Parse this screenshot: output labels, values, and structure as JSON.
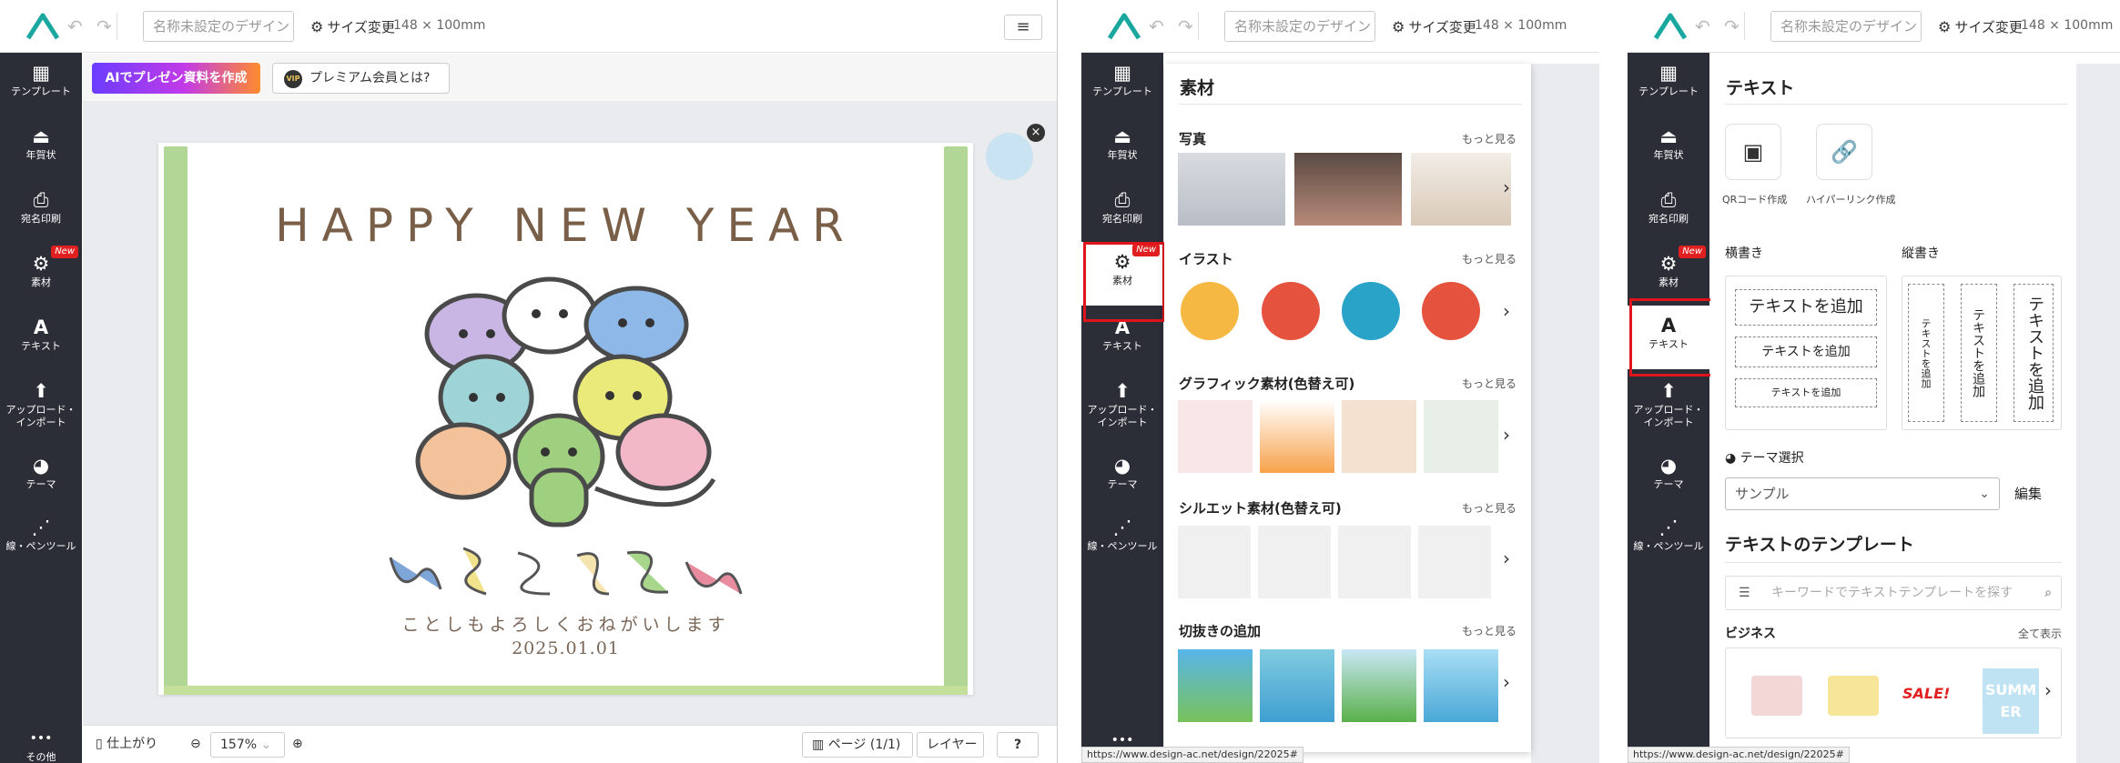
{
  "app": {
    "undo_icon": "undo-icon",
    "redo_icon": "redo-icon",
    "title_placeholder": "名称未設定のデザイン",
    "resize_label": "サイズ変更",
    "dimensions": "148 × 100mm",
    "menu_icon": "≡"
  },
  "sidebar": {
    "items": [
      {
        "icon": "▦",
        "label": "テンプレート"
      },
      {
        "icon": "⏏",
        "label": "年賀状"
      },
      {
        "icon": "⎙",
        "label": "宛名印刷"
      },
      {
        "icon": "⚙",
        "label": "素材",
        "badge": "New"
      },
      {
        "icon": "A",
        "label": "テキスト"
      },
      {
        "icon": "⬆",
        "label": "アップロード・\nインポート"
      },
      {
        "icon": "◕",
        "label": "テーマ"
      },
      {
        "icon": "⋰",
        "label": "線・ペンツール"
      }
    ],
    "more": {
      "icon": "•••",
      "label": "その他"
    }
  },
  "editor": {
    "ai_button": "AIでプレゼン資料を作成",
    "vip_badge": "VIP",
    "vip_button": "プレミアム会員とは?",
    "card": {
      "headline": "HAPPY NEW YEAR",
      "greeting": "ことしもよろしくおねがいします",
      "date": "2025.01.01"
    },
    "close_icon": "×",
    "bottom": {
      "finish": "仕上がり",
      "zoom": "157%",
      "page_label": "ページ",
      "page_count": "(1/1)",
      "layer": "レイヤー",
      "help": "?"
    }
  },
  "materials_panel": {
    "title": "素材",
    "more_label": "もっと見る",
    "sections": [
      {
        "label": "写真"
      },
      {
        "label": "イラスト"
      },
      {
        "label": "グラフィック素材(色替え可)"
      },
      {
        "label": "シルエット素材(色替え可)"
      },
      {
        "label": "切抜きの追加"
      }
    ],
    "status_url": "https://www.design-ac.net/design/22025#"
  },
  "text_panel": {
    "title": "テキスト",
    "qr_label": "QRコード作成",
    "link_label": "ハイパーリンク作成",
    "horizontal_label": "横書き",
    "vertical_label": "縦書き",
    "add_text": "テキストを追加",
    "theme_label": "テーマ選択",
    "theme_value": "サンプル",
    "edit_label": "編集",
    "templates_title": "テキストのテンプレート",
    "search_placeholder": "キーワードでテキストテンプレートを探す",
    "business_label": "ビジネス",
    "show_all": "全て表示",
    "status_url": "https://www.design-ac.net/design/22025#",
    "sample_sale": "SALE!",
    "sample_summer": "SUMMER"
  },
  "colors": {
    "sidebar": "#2b2e37",
    "accent_teal": "#1aa7a0",
    "highlight_red": "#e0141b",
    "new_badge": "#e02020"
  }
}
